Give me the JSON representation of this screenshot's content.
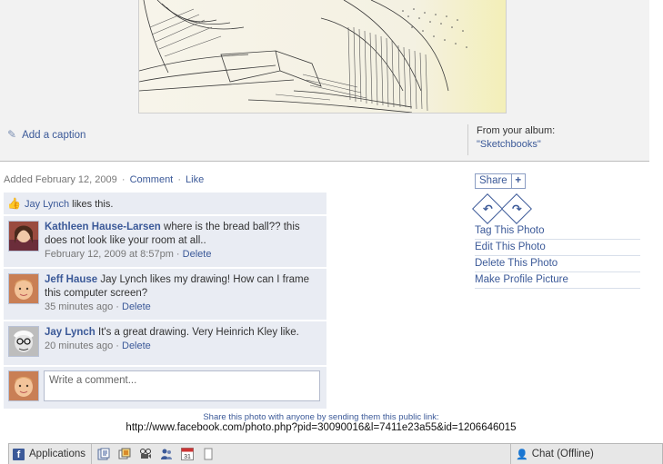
{
  "caption": {
    "add_label": "Add a caption"
  },
  "album": {
    "label": "From your album:",
    "name": "\"Sketchbooks\""
  },
  "meta": {
    "added": "Added February 12, 2009",
    "comment_label": "Comment",
    "like_label": "Like"
  },
  "likes": {
    "name": "Jay Lynch",
    "suffix": "likes this."
  },
  "comments": [
    {
      "author": "Kathleen Hause-Larsen",
      "text": "where is the bread ball?? this does not look like your room at all..",
      "time": "February 12, 2009 at 8:57pm",
      "delete": "Delete"
    },
    {
      "author": "Jeff Hause",
      "text": "Jay Lynch likes my drawing! How can I frame this computer screen?",
      "time": "35 minutes ago",
      "delete": "Delete"
    },
    {
      "author": "Jay Lynch",
      "text": "It's a great drawing. Very Heinrich Kley like.",
      "time": "20 minutes ago",
      "delete": "Delete"
    }
  ],
  "compose": {
    "placeholder": "Write a comment..."
  },
  "share": {
    "label": "Share",
    "plus": "+"
  },
  "rotate": {
    "left_icon": "rotate-left-icon",
    "right_icon": "rotate-right-icon"
  },
  "actions": [
    "Tag This Photo",
    "Edit This Photo",
    "Delete This Photo",
    "Make Profile Picture"
  ],
  "public_link": {
    "note": "Share this photo with anyone by sending them this public link:",
    "url": "http://www.facebook.com/photo.php?pid=30090016&l=7411e23a55&id=1206646015"
  },
  "bottom_bar": {
    "applications_label": "Applications",
    "calendar_day": "31",
    "chat_label": "Chat (Offline)",
    "icons": [
      "facebook-logo-icon",
      "notes-icon",
      "photos-icon",
      "video-icon",
      "friends-icon",
      "calendar-icon",
      "blank-page-icon",
      "chat-person-icon"
    ]
  },
  "colors": {
    "link": "#3b5998",
    "comment_bg": "#e9ecf3",
    "bar_bg": "#e7e7e7"
  }
}
